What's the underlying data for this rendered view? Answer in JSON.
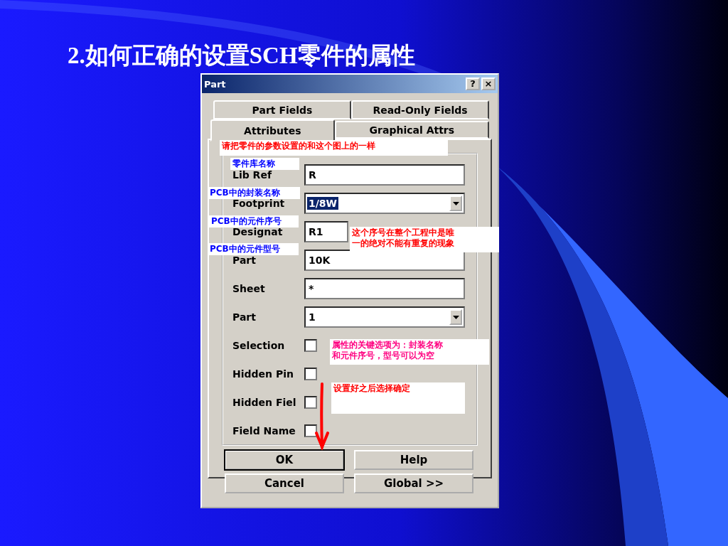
{
  "slide": {
    "title": "2.如何正确的设置SCH零件的属性"
  },
  "dialog": {
    "title": "Part",
    "title_buttons": [
      "?",
      "×"
    ],
    "tab_rows": [
      [
        {
          "label": "Part Fields",
          "selected": false
        },
        {
          "label": "Read-Only Fields",
          "selected": false
        }
      ],
      [
        {
          "label": "Attributes",
          "selected": true
        },
        {
          "label": "Graphical Attrs",
          "selected": false
        }
      ]
    ],
    "fields": [
      {
        "kind": "text",
        "label": "Lib Ref",
        "value": "R"
      },
      {
        "kind": "dropdown",
        "label": "Footprint",
        "value": "1/8W",
        "highlighted": true
      },
      {
        "kind": "text",
        "label": "Designat",
        "value": "R1"
      },
      {
        "kind": "text",
        "label": "Part",
        "value": "10K"
      },
      {
        "kind": "text",
        "label": "Sheet",
        "value": "*"
      },
      {
        "kind": "dropdown",
        "label": "Part",
        "value": "1",
        "highlighted": false
      },
      {
        "kind": "checkbox",
        "label": "Selection",
        "checked": false
      },
      {
        "kind": "checkbox",
        "label": "Hidden Pin",
        "checked": false
      },
      {
        "kind": "checkbox",
        "label": "Hidden Fiel",
        "checked": false
      },
      {
        "kind": "checkbox",
        "label": "Field Name",
        "checked": false
      }
    ],
    "buttons": [
      {
        "label": "OK",
        "default": true
      },
      {
        "label": "Help",
        "default": false
      },
      {
        "label": "Cancel",
        "default": false
      },
      {
        "label": "Global >>",
        "default": false
      }
    ]
  },
  "annotations": [
    {
      "lines": [
        "请把零件的参数设置的和这个图上的一样"
      ],
      "color": "#ff0000"
    },
    {
      "lines": [
        "零件库名称"
      ],
      "color": "#0000ff"
    },
    {
      "lines": [
        "PCB中的封装名称"
      ],
      "color": "#0000ff"
    },
    {
      "lines": [
        "PCB中的元件序号"
      ],
      "color": "#0000ff"
    },
    {
      "lines": [
        "PCB中的元件型号"
      ],
      "color": "#0000ff"
    },
    {
      "lines": [
        "这个序号在整个工程中是唯",
        "一的绝对不能有重复的现象"
      ],
      "color": "#ff0000"
    },
    {
      "lines": [
        "属性的关键选项为：封装名称",
        "和元件序号，型号可以为空"
      ],
      "color": "#ff0080"
    },
    {
      "lines": [
        "设置好之后选择确定"
      ],
      "color": "#ff0000"
    }
  ]
}
